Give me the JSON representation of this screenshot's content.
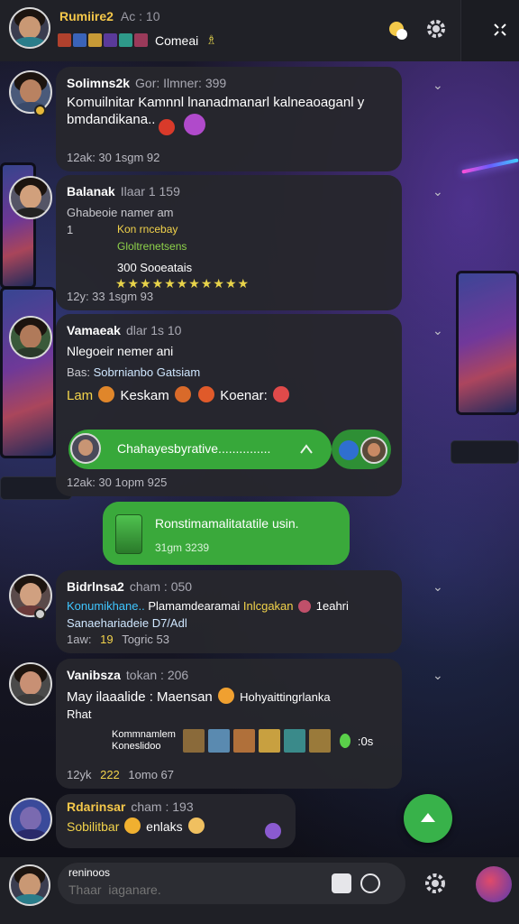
{
  "header": {
    "title": "Rumiire2",
    "time": "Ac : 10",
    "community_label": "Comeai",
    "trophy": "♗"
  },
  "messages": [
    {
      "name": "Solimns2k",
      "meta": "Gor: Ilmner: 399",
      "text": "Komuilnitar  Kamnnl lnanadmanarl kalneaoaganl y bmdandikana..",
      "foot": "12ak:  30  1sgm  92"
    },
    {
      "name": "Balanak",
      "meta": "Ilaar  1  159",
      "lines": [
        "Ghabeoie  namer am",
        "1"
      ],
      "green_lines": [
        "Kon rncebay",
        "Gloltrenetsens"
      ],
      "rating_label": "300 Sooeatais",
      "stars": "★★★★★★★★★★★",
      "foot": "12y:  33  1sgm  93"
    },
    {
      "name": "Vamaeak",
      "meta": "dlar  1s  10",
      "line1": "Nlegoeir  nemer ani",
      "line2_prefix": "Bas:",
      "line2_link": "Sobrnianbo Gatsiam",
      "line3_a": "Lam",
      "line3_b": "Keskam",
      "line3_c": "Koenar:",
      "reply_text": "Chahayesbyrative...............",
      "foot": "12ak:  30  1opm  925"
    },
    {
      "name": "Bidrlnsa2",
      "meta": "cham :  050",
      "line1_a": "Konumikhane..",
      "line1_b": "Plamamdearamai",
      "line1_c": "Inlcgakan",
      "line1_d": "1eahri",
      "line2": "Sanaehariadeie  D7/Adl",
      "foot_a": "1aw:",
      "foot_b": "19",
      "foot_c": "Togric  53"
    },
    {
      "name": "Vanibsza",
      "meta": "tokan :  206",
      "line1_a": "May  ilaaalide :  Maensan",
      "line1_b": "Hohyaittingrlanka",
      "line2": "Rhat",
      "small1": "Kommnamlem",
      "small2": "Koneslidoo",
      "tag": ":0s",
      "foot_a": "12yk",
      "foot_b": "222",
      "foot_c": "1omo  67"
    },
    {
      "name": "Rdarinsar",
      "meta": "cham :  193",
      "line_a": "Sobilitbar",
      "line_b": "enlaks"
    }
  ],
  "outgoing": {
    "text": "Ronstimamalitatatile usin.",
    "time": "31gm  3239"
  },
  "composer": {
    "label": "reninoos",
    "placeholder": "Thaar  iaganare."
  },
  "colors": {
    "accent_green": "#37a83a",
    "name_gold": "#f5c84a",
    "link_cyan": "#3fc6ff",
    "highlight_yellow": "#f2d34b"
  }
}
